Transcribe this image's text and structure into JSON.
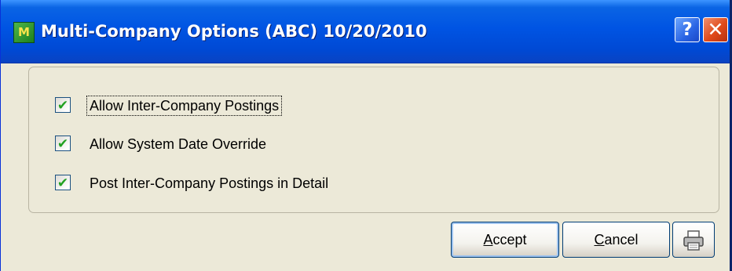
{
  "window": {
    "title": "Multi-Company Options (ABC) 10/20/2010",
    "app_icon_glyph": "M",
    "help_glyph": "?",
    "close_glyph": "✕"
  },
  "options": [
    {
      "label": "Allow Inter-Company Postings",
      "checked": true
    },
    {
      "label": "Allow System Date Override",
      "checked": true
    },
    {
      "label": "Post Inter-Company Postings in Detail",
      "checked": true
    }
  ],
  "checkmark_glyph": "✔",
  "buttons": {
    "accept": {
      "underline": "A",
      "rest": "ccept"
    },
    "cancel": {
      "underline": "C",
      "rest": "ancel"
    },
    "print_icon": "printer-icon"
  },
  "colors": {
    "titlebar": "#0054e3",
    "dialog_bg": "#ece9d8",
    "checkmark": "#21a121",
    "close_button": "#e04a1a"
  }
}
